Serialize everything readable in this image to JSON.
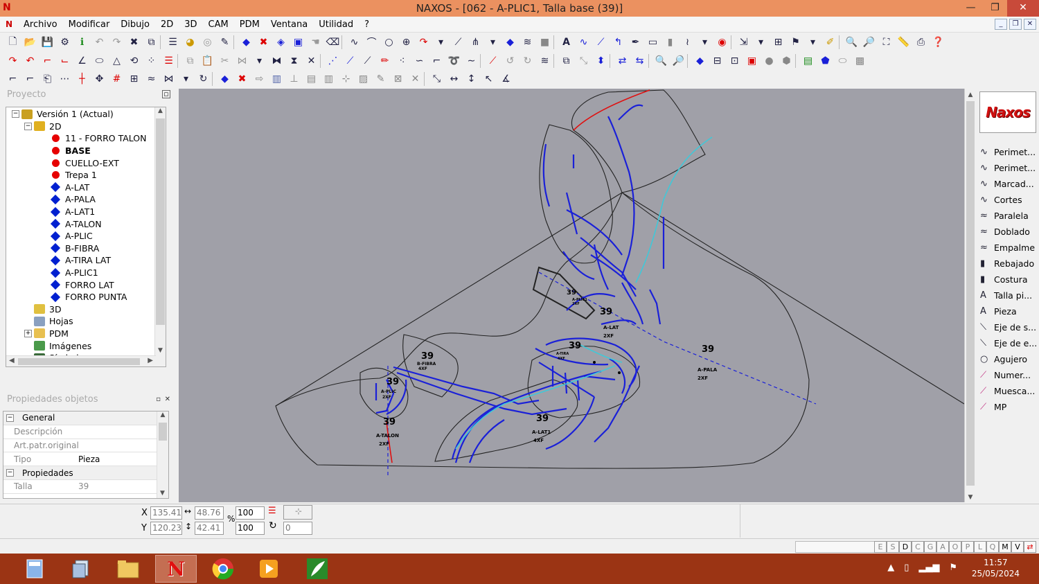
{
  "window": {
    "title": "NAXOS - [062 - A-PLIC1, Talla base (39)]",
    "minimize": "—",
    "maximize": "❐",
    "close": "✕"
  },
  "menu": [
    "Archivo",
    "Modificar",
    "Dibujo",
    "2D",
    "3D",
    "CAM",
    "PDM",
    "Ventana",
    "Utilidad",
    "?"
  ],
  "project_panel": {
    "title": "Proyecto",
    "tree": [
      {
        "label": "Versión 1 (Actual)",
        "level": 0,
        "icon": "version-icon",
        "expander": "−"
      },
      {
        "label": "2D",
        "level": 1,
        "icon": "layer-2d-icon",
        "expander": "−"
      },
      {
        "label": "11 - FORRO TALON",
        "level": 2,
        "icon": "red-dot"
      },
      {
        "label": "BASE",
        "level": 2,
        "icon": "red-dot",
        "bold": true
      },
      {
        "label": "CUELLO-EXT",
        "level": 2,
        "icon": "red-dot"
      },
      {
        "label": "Trepa 1",
        "level": 2,
        "icon": "red-dot"
      },
      {
        "label": "A-LAT",
        "level": 2,
        "icon": "blue-diamond"
      },
      {
        "label": "A-PALA",
        "level": 2,
        "icon": "blue-diamond"
      },
      {
        "label": "A-LAT1",
        "level": 2,
        "icon": "blue-diamond"
      },
      {
        "label": "A-TALON",
        "level": 2,
        "icon": "blue-diamond"
      },
      {
        "label": "A-PLIC",
        "level": 2,
        "icon": "blue-diamond"
      },
      {
        "label": "B-FIBRA",
        "level": 2,
        "icon": "blue-diamond"
      },
      {
        "label": "A-TIRA LAT",
        "level": 2,
        "icon": "blue-diamond"
      },
      {
        "label": "A-PLIC1",
        "level": 2,
        "icon": "blue-diamond"
      },
      {
        "label": "FORRO LAT",
        "level": 2,
        "icon": "blue-diamond"
      },
      {
        "label": "FORRO PUNTA",
        "level": 2,
        "icon": "blue-diamond"
      },
      {
        "label": "3D",
        "level": 1,
        "icon": "layer-3d-icon"
      },
      {
        "label": "Hojas",
        "level": 1,
        "icon": "sheets-icon"
      },
      {
        "label": "PDM",
        "level": 1,
        "icon": "folder-icon",
        "expander": "+"
      },
      {
        "label": "Imágenes",
        "level": 1,
        "icon": "images-icon"
      },
      {
        "label": "Símbolos",
        "level": 1,
        "icon": "symbols-icon"
      }
    ]
  },
  "properties_panel": {
    "title": "Propiedades objetos",
    "rows": [
      {
        "type": "section",
        "label": "General",
        "expander": "−"
      },
      {
        "type": "field",
        "label": "Descripción",
        "value": "",
        "button": "..."
      },
      {
        "type": "field",
        "label": "Art.patr.original",
        "value": ""
      },
      {
        "type": "field",
        "label": "Tipo",
        "value": "Pieza",
        "dropdown": true
      },
      {
        "type": "section",
        "label": "Propiedades",
        "expander": "−"
      },
      {
        "type": "field",
        "label": "Talla",
        "value": "39"
      }
    ]
  },
  "canvas_labels": [
    {
      "size": "39",
      "name": "A-TALON",
      "qty": "2XF"
    },
    {
      "size": "39",
      "name": "A-PLIC",
      "qty": "2XF"
    },
    {
      "size": "39",
      "name": "B-FIBRA",
      "qty": "4XF"
    },
    {
      "size": "39",
      "name": "A-LAT1",
      "qty": "4XF"
    },
    {
      "size": "39",
      "name": "A-TIRA",
      "qty": "4XF"
    },
    {
      "size": "39",
      "name": "A-LAT",
      "qty": "2XF"
    },
    {
      "size": "39",
      "name": "A-PALA",
      "qty": "2XF"
    },
    {
      "size": "39",
      "name": "A-PLIC1",
      "qty": "2XF"
    }
  ],
  "right_tools": {
    "logo": "Naxos",
    "items": [
      "Perimet...",
      "Perimet...",
      "Marcad...",
      "Cortes",
      "Paralela",
      "Doblado",
      "Empalme",
      "Rebajado",
      "Costura",
      "Talla pi...",
      "Pieza",
      "Eje de s...",
      "Eje de e...",
      "Agujero",
      "Numer...",
      "Muesca...",
      "MP"
    ]
  },
  "coords": {
    "x_label": "X",
    "x_value": "135.41",
    "y_label": "Y",
    "y_value": "120.23",
    "w_value": "48.76",
    "h_value": "42.41",
    "scale_x": "100",
    "scale_y": "100",
    "percent": "%",
    "rotation": "0"
  },
  "status_modes": [
    "E",
    "S",
    "D",
    "C",
    "G",
    "A",
    "O",
    "P",
    "L",
    "Q",
    "M",
    "V"
  ],
  "taskbar": {
    "time": "11:57",
    "date": "25/05/2024"
  },
  "colors": {
    "titlebar": "#eb9160",
    "taskbar": "#9b3414",
    "canvas": "#a0a0a8",
    "lines_blue": "#1a20d8",
    "lines_cyan": "#40c8d8",
    "lines_red": "#e01010"
  }
}
